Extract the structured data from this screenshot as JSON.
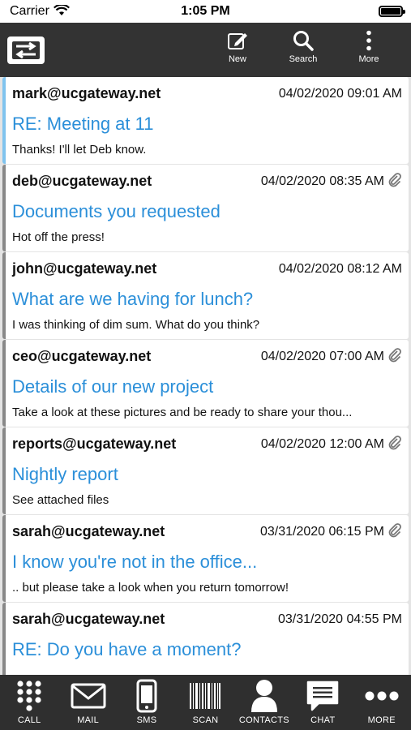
{
  "status": {
    "carrier": "Carrier",
    "time": "1:05 PM"
  },
  "toolbar": {
    "new_label": "New",
    "search_label": "Search",
    "more_label": "More"
  },
  "messages": [
    {
      "from": "mark@ucgateway.net",
      "date": "04/02/2020 09:01 AM",
      "subject": "RE: Meeting at 11",
      "preview": "Thanks! I'll let Deb know.",
      "unread": true,
      "attachment": false
    },
    {
      "from": "deb@ucgateway.net",
      "date": "04/02/2020 08:35 AM",
      "subject": "Documents you requested",
      "preview": "Hot off the press!",
      "unread": false,
      "attachment": true
    },
    {
      "from": "john@ucgateway.net",
      "date": "04/02/2020 08:12 AM",
      "subject": "What are we having for lunch?",
      "preview": "I was thinking of dim sum. What do you think?",
      "unread": false,
      "attachment": false
    },
    {
      "from": "ceo@ucgateway.net",
      "date": "04/02/2020 07:00 AM",
      "subject": "Details of our new project",
      "preview": "Take a look at these pictures and be ready to share your thou...",
      "unread": false,
      "attachment": true
    },
    {
      "from": "reports@ucgateway.net",
      "date": "04/02/2020 12:00 AM",
      "subject": "Nightly report",
      "preview": "See attached files",
      "unread": false,
      "attachment": true
    },
    {
      "from": "sarah@ucgateway.net",
      "date": "03/31/2020 06:15 PM",
      "subject": "I know you're not in the office...",
      "preview": ".. but please take a look when you return tomorrow!",
      "unread": false,
      "attachment": true
    },
    {
      "from": "sarah@ucgateway.net",
      "date": "03/31/2020 04:55 PM",
      "subject": "RE: Do you have a moment?",
      "preview": "",
      "unread": false,
      "attachment": false
    }
  ],
  "tabs": [
    {
      "label": "CALL",
      "icon": "dialpad-icon"
    },
    {
      "label": "MAIL",
      "icon": "mail-icon"
    },
    {
      "label": "SMS",
      "icon": "phone-icon"
    },
    {
      "label": "SCAN",
      "icon": "barcode-icon"
    },
    {
      "label": "CONTACTS",
      "icon": "contact-icon"
    },
    {
      "label": "CHAT",
      "icon": "chat-icon"
    },
    {
      "label": "MORE",
      "icon": "more-dots-icon"
    }
  ]
}
